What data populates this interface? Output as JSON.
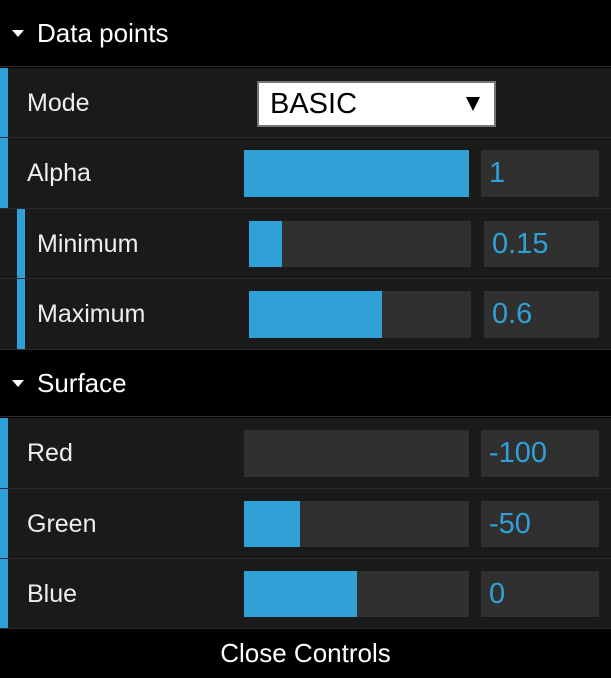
{
  "folders": [
    {
      "title": "Data points"
    },
    {
      "title": "Surface"
    }
  ],
  "data_points": {
    "mode": {
      "label": "Mode",
      "selected": "BASIC"
    },
    "alpha": {
      "label": "Alpha",
      "value": "1",
      "fraction": 1.0
    },
    "minimum": {
      "label": "Minimum",
      "value": "0.15",
      "fraction": 0.15
    },
    "maximum": {
      "label": "Maximum",
      "value": "0.6",
      "fraction": 0.6
    }
  },
  "surface": {
    "red": {
      "label": "Red",
      "value": "-100",
      "fraction": 0.0
    },
    "green": {
      "label": "Green",
      "value": "-50",
      "fraction": 0.25
    },
    "blue": {
      "label": "Blue",
      "value": "0",
      "fraction": 0.5
    }
  },
  "close_label": "Close Controls",
  "colors": {
    "accent": "#2fa1d6",
    "row_bg": "#1a1a1a",
    "field_bg": "#303030"
  }
}
